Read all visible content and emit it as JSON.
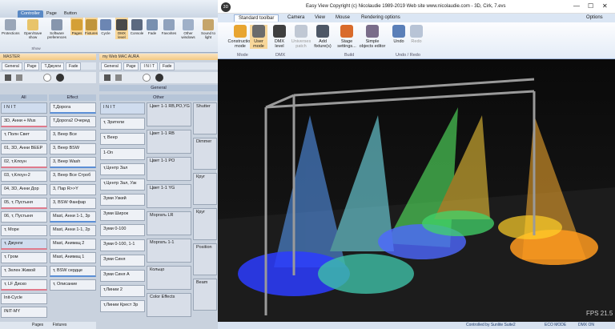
{
  "left_app": {
    "tabs": [
      "Controller",
      "Page",
      "Button"
    ],
    "ribbon": {
      "items": [
        "Protections",
        "Open/Save show",
        "Software preferences",
        "Cycle",
        "Pages",
        "Fixtures",
        "DMX level",
        "Console",
        "Fade",
        "Favorites",
        "Other windows",
        "Sound to light"
      ],
      "group_show": "Show"
    },
    "master_panel": {
      "title": "MASTER",
      "subtabs": [
        "General",
        "Page",
        "T.Джунги",
        "Fade"
      ],
      "col_all": "All",
      "col_effect": "Effect",
      "all_cells": [
        "I N I T",
        "3D, Анни + Mus",
        "т, Полн Свет",
        "01, 3D, Анни BEEP",
        "02, т,Клоун",
        "03, т,Клоун-2",
        "04, 3D, Анни Дор",
        "05, т, Пустыня",
        "06, т, Пустыня",
        "т, Море",
        "т, Джунги",
        "т, Гром",
        "т, Зелен Живой",
        "т, LF Диско",
        "Init-Cycle",
        "INIT-MY"
      ],
      "effect_cells": [
        "Т,Дорога",
        "Т,Дорога2 Очеред",
        "3, Beep Все",
        "3, Beep BSW",
        "3, Beep Wash",
        "3, Beep Все Строб",
        "3, Пар R>>Y",
        "3, BSW Фанфар",
        "Mast, Анни 1-1, 3р",
        "Mast, Анни 1-1, 2р",
        "Mast, Анимац 2",
        "Mast, Анимац 1",
        "т, BSW сердце",
        "т, Описание"
      ]
    },
    "fixture_panel": {
      "title": "my Web MAC AURA",
      "subtabs": [
        "General",
        "Page",
        "I N I T",
        "Fade"
      ],
      "group_general": "General",
      "group_other": "Other",
      "col1": [
        "I N I T",
        "т, Зрители",
        "т, Веер",
        "1-On",
        "т,Центр Зал",
        "т,Центр Зал, Узк",
        "Зуми Узкий",
        "Зуми Широк",
        "Зуми 0-100",
        "Зуми 0-100, 1-1",
        "Зуми Синя",
        "Зуми Синя А",
        "т,Линии 2",
        "т,Линии Крест Зр"
      ],
      "col2": [
        "Цвет 1-1 RB,PO,YG",
        "Цвет 1-1 RB",
        "Цвет 1-1 PO",
        "Цвет 1-1 YG",
        "Моргать LR",
        "Моргать 1-1",
        "Кольцо",
        "Color Effects"
      ],
      "col3": [
        "Shutter",
        "Dimmer",
        "Круг",
        "Круг",
        "Position",
        "Beam"
      ]
    },
    "bottom_tabs": [
      "Pages",
      "Fixtures"
    ]
  },
  "right_app": {
    "title": "Easy View   Copyright (c) Nicolaudie 1989-2019   Web site www.nicolaudie.com - 3D, Cirk, 7.evs",
    "tabs": [
      "Standard toolbar",
      "Camera",
      "View",
      "Mouse",
      "Rendering options"
    ],
    "options_label": "Options",
    "ribbon": {
      "items": [
        "Construction mode",
        "User mode",
        "DMX level",
        "Universes patch",
        "Add fixture(s)",
        "Stage settings...",
        "Simple objects editor",
        "Undo",
        "Redo"
      ],
      "groups": [
        "Mode",
        "DMX",
        "Build",
        "Undo / Redo"
      ]
    },
    "fps": "FPS 21.5",
    "status": {
      "controlled": "Controlled by Sunlite Suite2",
      "eco": "ECO MODE",
      "dmx": "DMX ON"
    }
  },
  "colors": {
    "accent": "#5a89c4",
    "panel_header": "#f3c984",
    "status_text": "#1d3b6b"
  }
}
